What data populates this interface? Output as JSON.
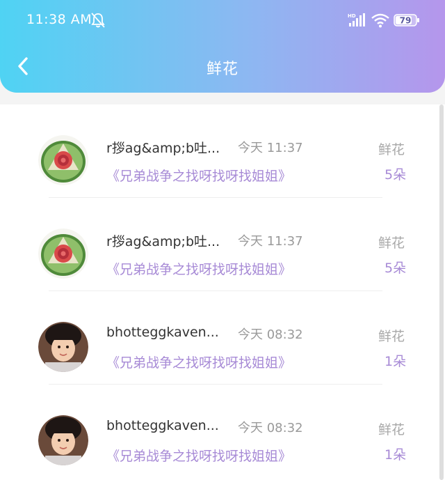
{
  "status_bar": {
    "time": "11:38 AM",
    "network": "HD",
    "battery": "79"
  },
  "header": {
    "title": "鲜花"
  },
  "records": [
    {
      "avatar": "watermelon-flower-carving",
      "username": "r拶ag&amp;b吐...",
      "time": "今天 11:37",
      "gift_type": "鲜花",
      "gift_name": "《兄弟战争之找呀找呀找姐姐》",
      "count": "5朵"
    },
    {
      "avatar": "watermelon-flower-carving",
      "username": "r拶ag&amp;b吐...",
      "time": "今天 11:37",
      "gift_type": "鲜花",
      "gift_name": "《兄弟战争之找呀找呀找姐姐》",
      "count": "5朵"
    },
    {
      "avatar": "child-photo",
      "username": "bhotteggkaven...",
      "time": "今天 08:32",
      "gift_type": "鲜花",
      "gift_name": "《兄弟战争之找呀找呀找姐姐》",
      "count": "1朵"
    },
    {
      "avatar": "child-photo",
      "username": "bhotteggkaven...",
      "time": "今天 08:32",
      "gift_type": "鲜花",
      "gift_name": "《兄弟战争之找呀找呀找姐姐》",
      "count": "1朵"
    }
  ],
  "colors": {
    "header_left": "#4fd3f3",
    "header_right": "#b596ec",
    "accent_purple": "#a78ad6"
  }
}
